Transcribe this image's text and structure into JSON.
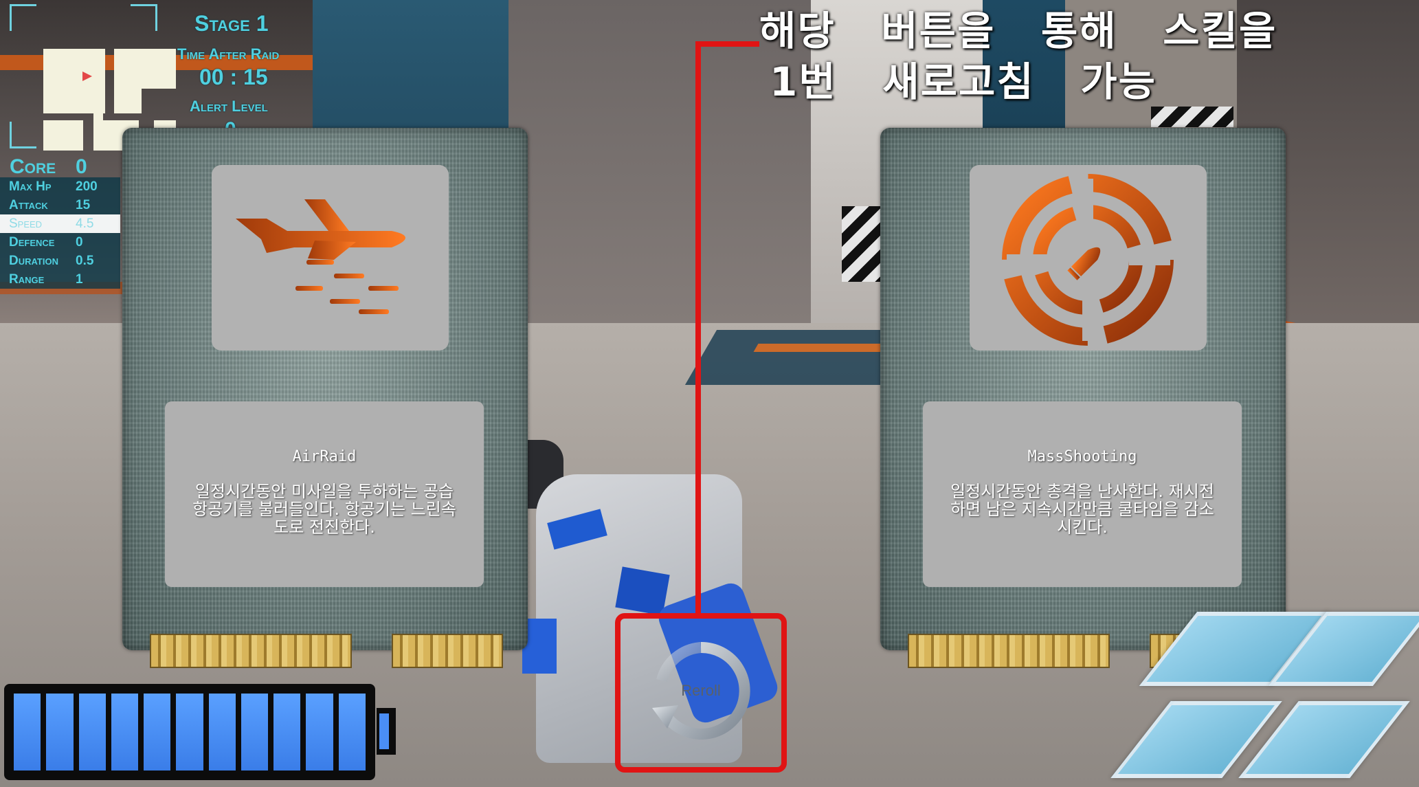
{
  "hud": {
    "stage_title": "Stage 1",
    "time_label": "Time After Raid",
    "time_value": "00 : 15",
    "alert_label": "Alert Level",
    "alert_value": "0"
  },
  "stats": {
    "core_label": "Core",
    "core_value": "0",
    "rows": [
      {
        "label": "Max Hp",
        "value": "200"
      },
      {
        "label": "Attack",
        "value": "15"
      },
      {
        "label": "Speed",
        "value": "4.5"
      },
      {
        "label": "Defence",
        "value": "0"
      },
      {
        "label": "Duration",
        "value": "0.5"
      },
      {
        "label": "Range",
        "value": "1"
      }
    ]
  },
  "annotation": {
    "line1": "해당   버튼을   통해   스킬을",
    "line2": "1번   새로고침   가능"
  },
  "cards": [
    {
      "name": "AirRaid",
      "icon": "airplane-bomber-icon",
      "description": "일정시간동안 미사일을 투하하는 공습\n항공기를 불러들인다. 항공기는 느린속\n도로 전진한다."
    },
    {
      "name": "MassShooting",
      "icon": "crosshair-bullet-icon",
      "description": "일정시간동안 총격을 난사한다. 재시전\n하면 남은 지속시간만큼 쿨타임을 감소\n시킨다."
    }
  ],
  "reroll": {
    "label": "Reroll",
    "icon": "circular-arrow-icon"
  },
  "battery": {
    "cells_filled": 11,
    "cells_total": 11
  },
  "colors": {
    "hud_cyan": "#4fd0e0",
    "annotation_red": "#e01414",
    "icon_orange": "#e8641a",
    "battery_blue": "#4a8ef5"
  }
}
